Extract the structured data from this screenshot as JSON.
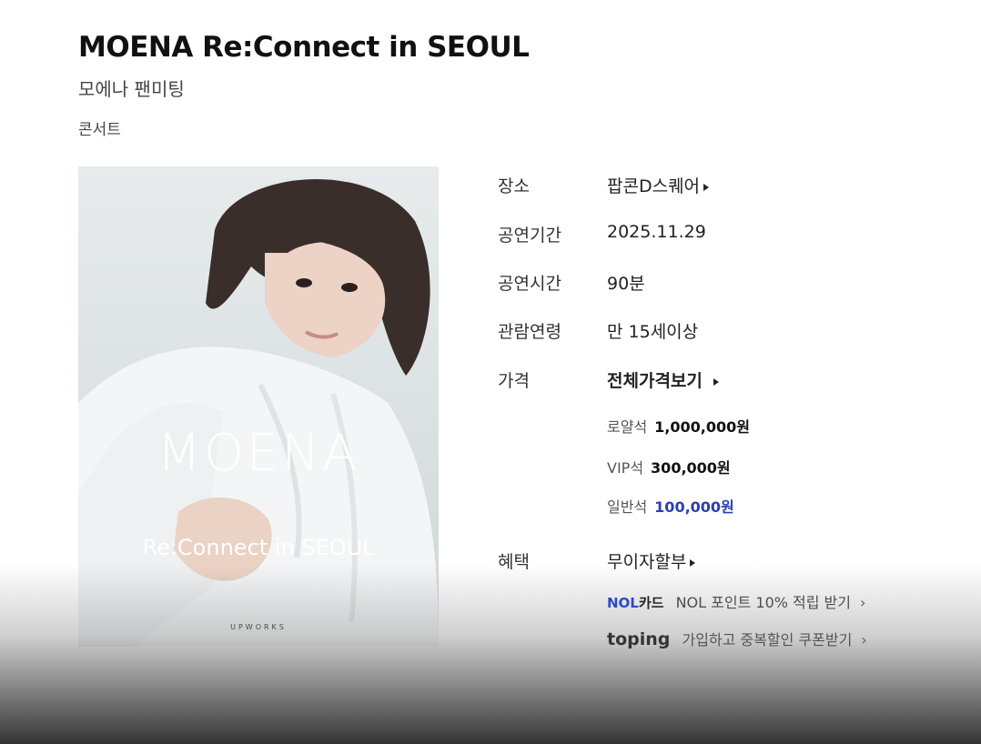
{
  "header": {
    "title": "MOENA Re:Connect in SEOUL",
    "subtitle": "모에나 팬미팅",
    "genre": "콘서트"
  },
  "poster": {
    "title": "MOENA",
    "subtitle": "Re:Connect in SEOUL",
    "date_line": "2025.11.29 6F, POPCORN D SQUARE, I'PARK MALL",
    "logo": "UPWORKS"
  },
  "info": {
    "venue_label": "장소",
    "venue_value": "팝콘D스퀘어",
    "period_label": "공연기간",
    "period_value": "2025.11.29",
    "duration_label": "공연시간",
    "duration_value": "90분",
    "age_label": "관람연령",
    "age_value": "만 15세이상",
    "price_label": "가격",
    "price_link": "전체가격보기",
    "prices": [
      {
        "label": "로얄석",
        "value": "1,000,000원"
      },
      {
        "label": "VIP석",
        "value": "300,000원"
      },
      {
        "label": "일반석",
        "value": "100,000원"
      }
    ],
    "benefit_label": "혜택",
    "benefit_link": "무이자할부",
    "benefits": [
      {
        "logo_main": "NOL",
        "logo_suffix": "카드",
        "text": "NOL 포인트 10% 적립 받기",
        "chevron": "›"
      },
      {
        "logo_main": "toping",
        "text": "가입하고 중복할인 쿠폰받기",
        "chevron": "›"
      }
    ]
  },
  "colors": {
    "accent_blue": "#2b3fb3",
    "nol_blue": "#1e3cd8"
  }
}
